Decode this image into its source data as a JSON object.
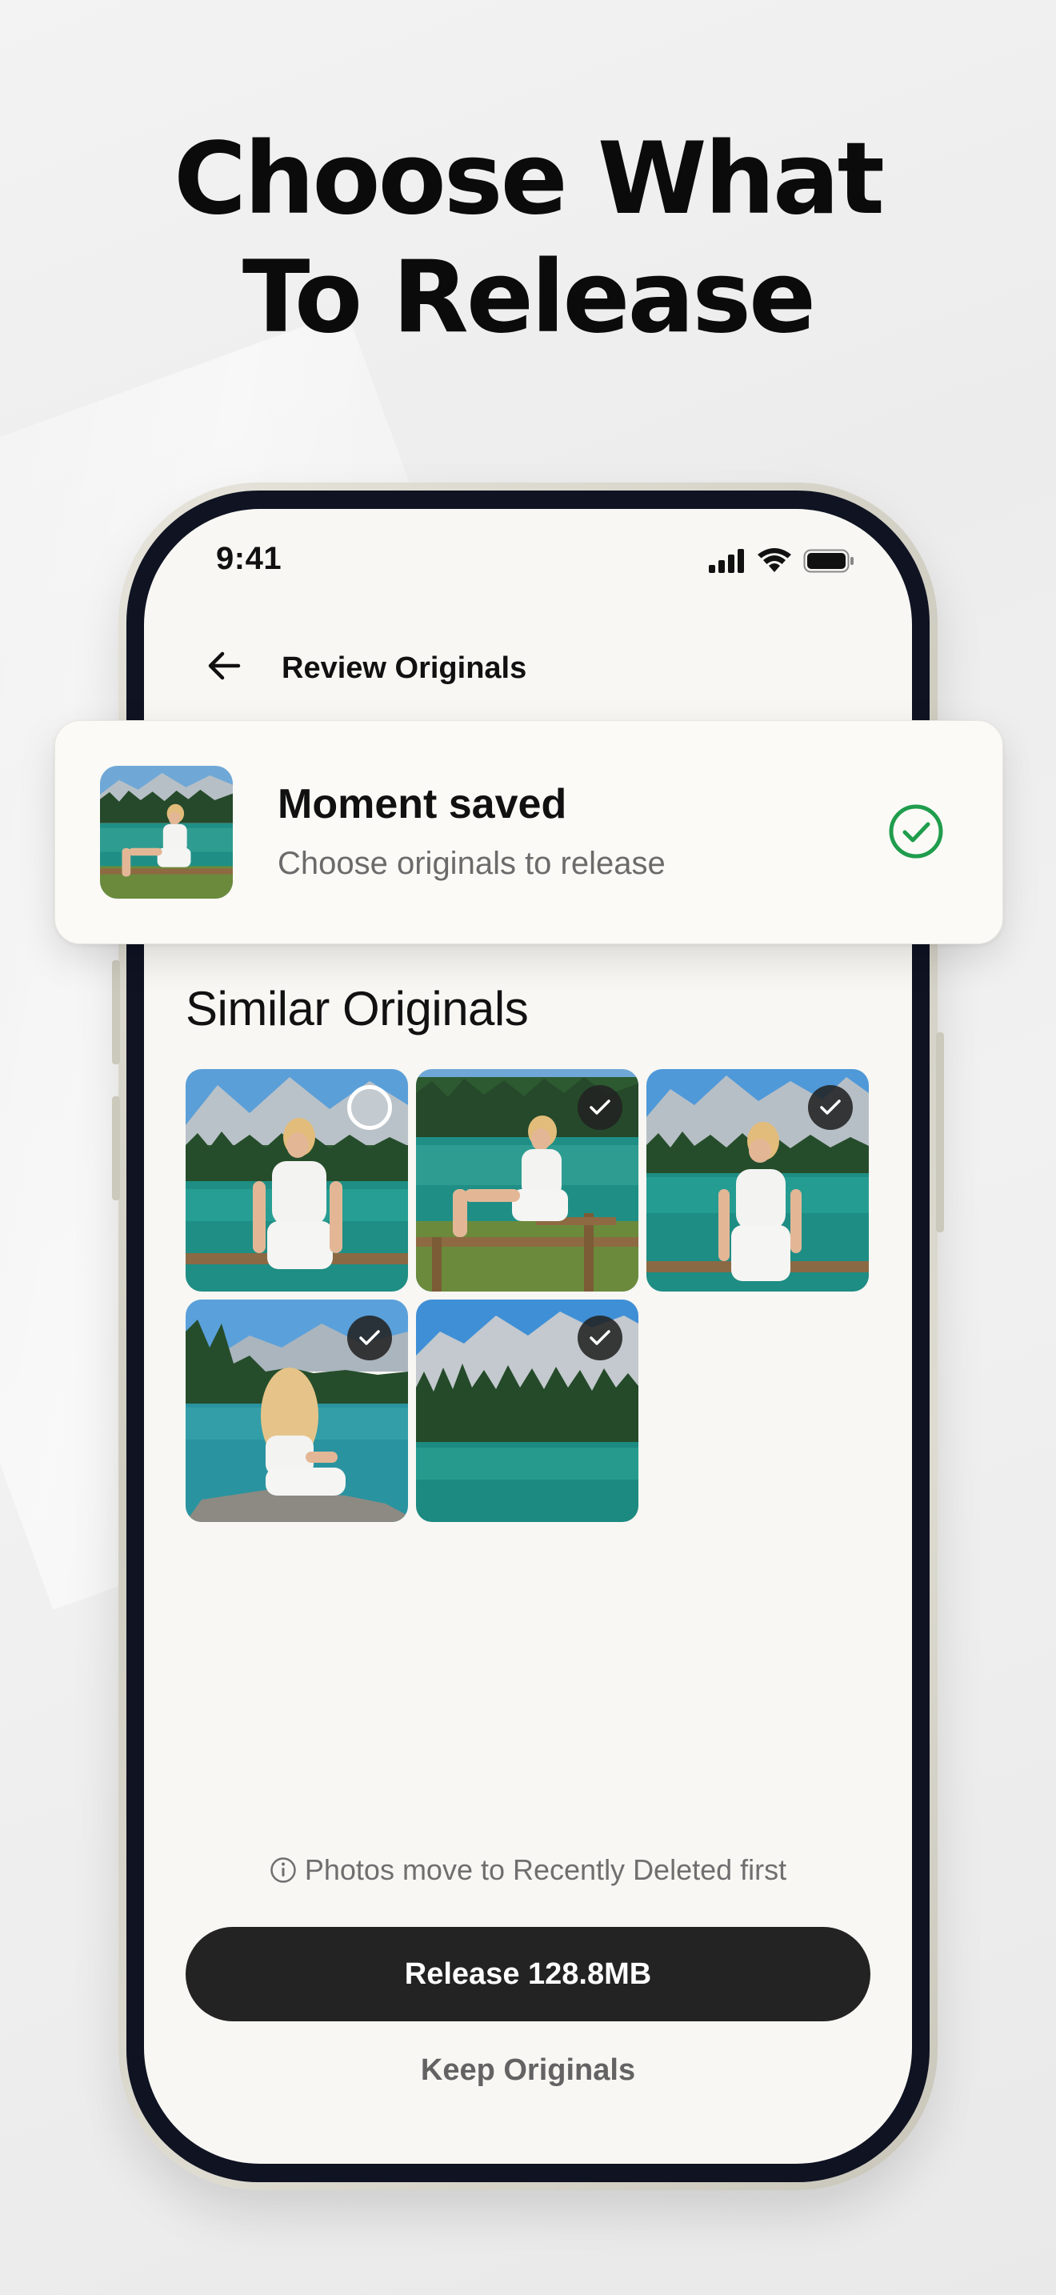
{
  "headline": {
    "line1": "Choose What",
    "line2": "To Release"
  },
  "status_bar": {
    "time": "9:41",
    "icons": [
      "cellular-signal-icon",
      "wifi-icon",
      "battery-icon"
    ]
  },
  "nav": {
    "back_icon": "arrow-left-icon",
    "title": "Review Originals"
  },
  "toast": {
    "title": "Moment saved",
    "subtitle": "Choose originals to release",
    "status_icon": "check-circle-icon",
    "accent_color": "#1f9d4c"
  },
  "section": {
    "title": "Similar Originals"
  },
  "photos": [
    {
      "scene": "woman in white outfit sitting on wooden fence by alpine lake",
      "selected": false
    },
    {
      "scene": "woman sitting on wooden fence, lake and forest behind",
      "selected": true
    },
    {
      "scene": "woman in sunglasses leaning on fence by turquoise lake",
      "selected": true
    },
    {
      "scene": "woman sitting on rock facing the lake",
      "selected": true
    },
    {
      "scene": "alpine lake with pine forest and rocky mountains",
      "selected": true
    }
  ],
  "footer": {
    "info_icon": "info-icon",
    "note": "Photos move to Recently Deleted first",
    "release_label": "Release 128.8MB",
    "keep_label": "Keep Originals"
  },
  "colors": {
    "primary_button": "#232323",
    "screen_bg": "#f8f7f3"
  }
}
